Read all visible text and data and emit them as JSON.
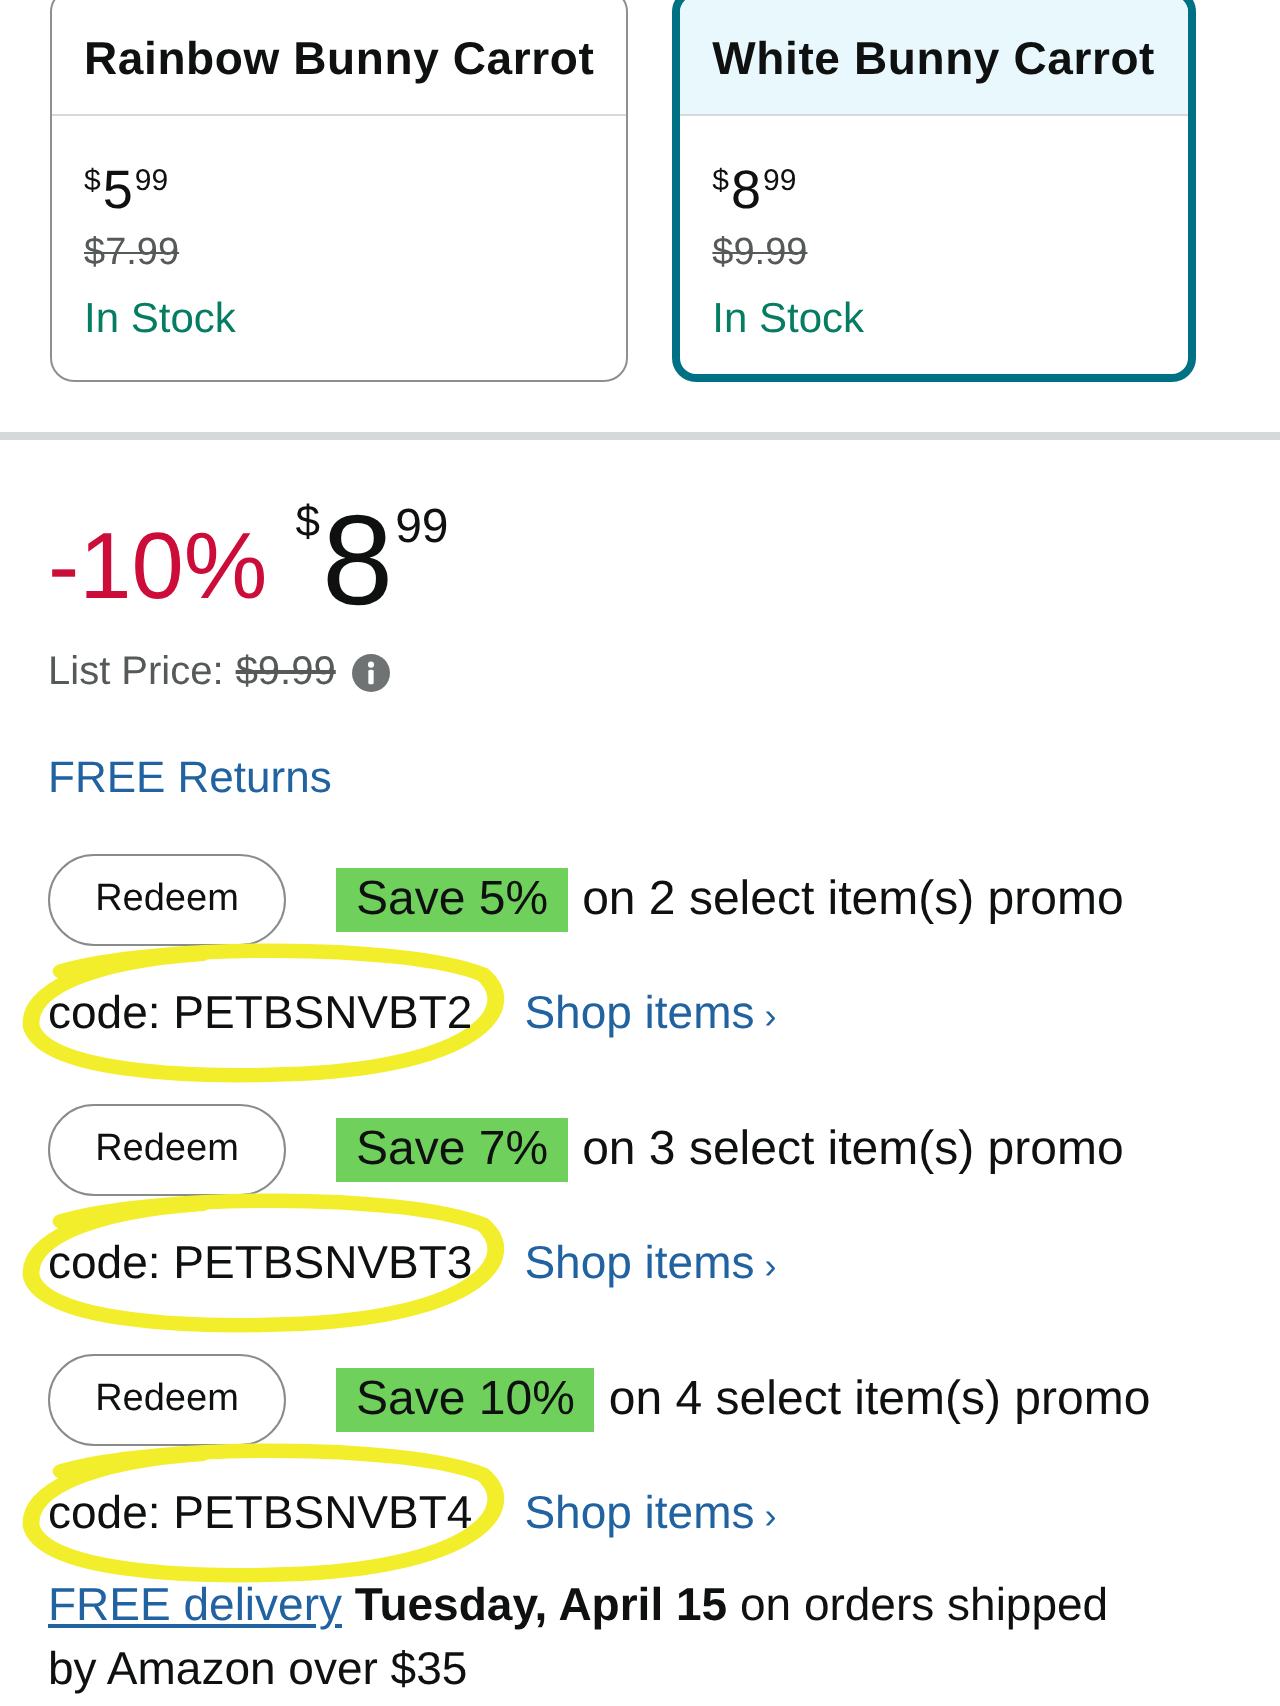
{
  "variant_cards": [
    {
      "title": "Rainbow Bunny Carrot",
      "price": {
        "symbol": "$",
        "whole": "5",
        "fraction": "99"
      },
      "list_price": "$7.99",
      "availability": "In Stock",
      "selected": false
    },
    {
      "title": "White Bunny Carrot",
      "price": {
        "symbol": "$",
        "whole": "8",
        "fraction": "99"
      },
      "list_price": "$9.99",
      "availability": "In Stock",
      "selected": true
    }
  ],
  "price_block": {
    "discount": "-10%",
    "price": {
      "symbol": "$",
      "whole": "8",
      "fraction": "99"
    },
    "list_price_label": "List Price:",
    "list_price": "$9.99"
  },
  "returns_link": "FREE Returns",
  "promos": [
    {
      "button": "Redeem",
      "badge": "Save 5%",
      "text": "on 2 select item(s) promo",
      "code": "code: PETBSNVBT2",
      "link": "Shop items",
      "link_arrow": "›",
      "circled": true
    },
    {
      "button": "Redeem",
      "badge": "Save 7%",
      "text": "on 3 select item(s) promo",
      "code": "code: PETBSNVBT3",
      "link": "Shop items",
      "link_arrow": "›",
      "circled": true
    },
    {
      "button": "Redeem",
      "badge": "Save 10%",
      "text": "on 4 select item(s) promo",
      "code": "code: PETBSNVBT4",
      "link": "Shop items",
      "link_arrow": "›",
      "circled": true
    }
  ],
  "delivery": {
    "link": "FREE delivery",
    "text": "**Tuesday, April 15** on orders shipped by Amazon over $35"
  }
}
